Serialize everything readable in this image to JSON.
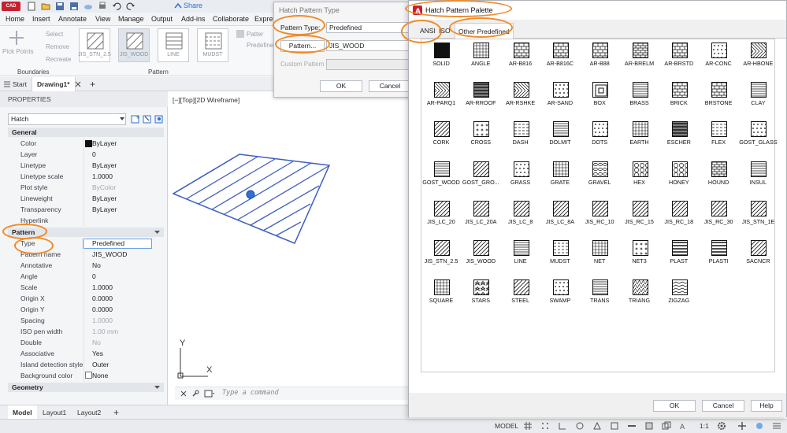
{
  "app": {
    "badge": "CAD",
    "share_label": "Share",
    "menus": [
      "Home",
      "Insert",
      "Annotate",
      "View",
      "Manage",
      "Output",
      "Add-ins",
      "Collaborate",
      "Expre"
    ]
  },
  "ribbon": {
    "pick_points": "Pick Points",
    "select": "Select",
    "remove": "Remove",
    "recreate": "Recreate",
    "boundaries": "Boundaries",
    "pattern_group": "Pattern",
    "pattern_tiles": [
      "JIS_STN_2.5",
      "JIS_WOOD",
      "LINE",
      "MUDST"
    ],
    "pattern_right": "Patter",
    "pattern_right2": "Predefined"
  },
  "tabs": {
    "start": "Start",
    "drawing": "Drawing1*",
    "add": "+"
  },
  "properties": {
    "header": "PROPERTIES",
    "object": "Hatch",
    "general_title": "General",
    "general": [
      {
        "k": "Color",
        "v": "ByLayer"
      },
      {
        "k": "Layer",
        "v": "0"
      },
      {
        "k": "Linetype",
        "v": "ByLayer"
      },
      {
        "k": "Linetype scale",
        "v": "1.0000"
      },
      {
        "k": "Plot style",
        "v": "ByColor"
      },
      {
        "k": "Lineweight",
        "v": "ByLayer"
      },
      {
        "k": "Transparency",
        "v": "ByLayer"
      },
      {
        "k": "Hyperlink",
        "v": ""
      }
    ],
    "pattern_title": "Pattern",
    "pattern": [
      {
        "k": "Type",
        "v": "Predefined"
      },
      {
        "k": "Pattern name",
        "v": "JIS_WOOD"
      },
      {
        "k": "Annotative",
        "v": "No"
      },
      {
        "k": "Angle",
        "v": "0"
      },
      {
        "k": "Scale",
        "v": "1.0000"
      },
      {
        "k": "Origin X",
        "v": "0.0000"
      },
      {
        "k": "Origin Y",
        "v": "0.0000"
      },
      {
        "k": "Spacing",
        "v": "1.0000"
      },
      {
        "k": "ISO pen width",
        "v": "1.00 mm"
      },
      {
        "k": "Double",
        "v": "No"
      },
      {
        "k": "Associative",
        "v": "Yes"
      },
      {
        "k": "Island detection style",
        "v": "Outer"
      },
      {
        "k": "Background color",
        "v": "None"
      }
    ],
    "geometry_title": "Geometry"
  },
  "viewport": {
    "label": "[−][Top][2D Wireframe]",
    "axis_y": "Y",
    "axis_x": "X",
    "command_placeholder": "Type a command"
  },
  "layout_tabs": [
    "Model",
    "Layout1",
    "Layout2",
    "+"
  ],
  "status": {
    "model": "MODEL",
    "scale": "1:1"
  },
  "hatch_type_dialog": {
    "title": "Hatch Pattern Type",
    "pattern_type_label": "Pattern Type:",
    "pattern_type_value": "Predefined",
    "pattern_button": "Pattern...",
    "pattern_value": "JIS_WOOD",
    "custom_label": "Custom Pattern",
    "ok": "OK",
    "cancel": "Cancel"
  },
  "palette_dialog": {
    "title": "Hatch Pattern Palette",
    "tabs": [
      "ANSI",
      "ISO",
      "Other Predefined"
    ],
    "patterns": [
      {
        "name": "SOLID",
        "style": "solid"
      },
      {
        "name": "ANGLE",
        "style": "grid"
      },
      {
        "name": "AR-B816",
        "style": "brick"
      },
      {
        "name": "AR-B816C",
        "style": "brick"
      },
      {
        "name": "AR-B88",
        "style": "brick"
      },
      {
        "name": "AR-BRELM",
        "style": "densebrick"
      },
      {
        "name": "AR-BRSTD",
        "style": "brick"
      },
      {
        "name": "AR-CONC",
        "style": "dots"
      },
      {
        "name": "AR-HBONE",
        "style": "herring"
      },
      {
        "name": "AR-PARQ1",
        "style": "parquet"
      },
      {
        "name": "AR-RROOF",
        "style": "dark"
      },
      {
        "name": "AR-RSHKE",
        "style": "shake"
      },
      {
        "name": "AR-SAND",
        "style": "dots"
      },
      {
        "name": "BOX",
        "style": "box"
      },
      {
        "name": "BRASS",
        "style": "hlines"
      },
      {
        "name": "BRICK",
        "style": "brick"
      },
      {
        "name": "BRSTONE",
        "style": "brick"
      },
      {
        "name": "CLAY",
        "style": "hlines"
      },
      {
        "name": "CORK",
        "style": "diag"
      },
      {
        "name": "CROSS",
        "style": "cross"
      },
      {
        "name": "DASH",
        "style": "dash"
      },
      {
        "name": "DOLMIT",
        "style": "hlines"
      },
      {
        "name": "DOTS",
        "style": "dots"
      },
      {
        "name": "EARTH",
        "style": "grid"
      },
      {
        "name": "ESCHER",
        "style": "dark"
      },
      {
        "name": "FLEX",
        "style": "dash"
      },
      {
        "name": "GOST_GLASS",
        "style": "dots"
      },
      {
        "name": "GOST_WOOD",
        "style": "hlines"
      },
      {
        "name": "GOST_GRO...",
        "style": "diag"
      },
      {
        "name": "GRASS",
        "style": "dots"
      },
      {
        "name": "GRATE",
        "style": "grid"
      },
      {
        "name": "GRAVEL",
        "style": "stones"
      },
      {
        "name": "HEX",
        "style": "hex"
      },
      {
        "name": "HONEY",
        "style": "hex"
      },
      {
        "name": "HOUND",
        "style": "densebrick"
      },
      {
        "name": "INSUL",
        "style": "hlines"
      },
      {
        "name": "JIS_LC_20",
        "style": "diag"
      },
      {
        "name": "JIS_LC_20A",
        "style": "diag"
      },
      {
        "name": "JIS_LC_8",
        "style": "diag"
      },
      {
        "name": "JIS_LC_8A",
        "style": "diag"
      },
      {
        "name": "JIS_RC_10",
        "style": "diag"
      },
      {
        "name": "JIS_RC_15",
        "style": "diag"
      },
      {
        "name": "JIS_RC_18",
        "style": "diag"
      },
      {
        "name": "JIS_RC_30",
        "style": "diag"
      },
      {
        "name": "JIS_STN_1E",
        "style": "diag"
      },
      {
        "name": "JIS_STN_2.5",
        "style": "diag"
      },
      {
        "name": "JIS_WOOD",
        "style": "diag"
      },
      {
        "name": "LINE",
        "style": "hlines"
      },
      {
        "name": "MUDST",
        "style": "dash"
      },
      {
        "name": "NET",
        "style": "grid"
      },
      {
        "name": "NET3",
        "style": "cross"
      },
      {
        "name": "PLAST",
        "style": "hthick"
      },
      {
        "name": "PLASTI",
        "style": "hthick"
      },
      {
        "name": "SACNCR",
        "style": "diag"
      },
      {
        "name": "SQUARE",
        "style": "grid"
      },
      {
        "name": "STARS",
        "style": "stars"
      },
      {
        "name": "STEEL",
        "style": "diag"
      },
      {
        "name": "SWAMP",
        "style": "dots"
      },
      {
        "name": "TRANS",
        "style": "hlines"
      },
      {
        "name": "TRIANG",
        "style": "triang"
      },
      {
        "name": "ZIGZAG",
        "style": "zigzag"
      }
    ],
    "ok": "OK",
    "cancel": "Cancel",
    "help": "Help"
  },
  "colors": {
    "accent": "#2f6fd6",
    "hatch_line": "#3d5fbf",
    "annotation": "#f08a2a",
    "app_red": "#c8202f"
  }
}
